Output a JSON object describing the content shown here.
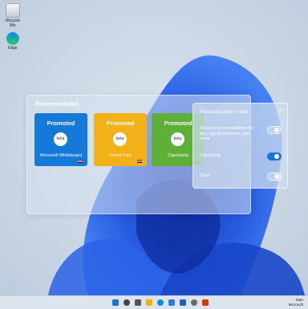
{
  "desktop": {
    "icons": [
      {
        "label": "Recycle Bin",
        "icon": "recycle-bin-icon"
      },
      {
        "label": "Edge",
        "icon": "edge-icon"
      }
    ]
  },
  "recommended": {
    "title": "Recommended",
    "cards": [
      {
        "promo": "Promoted",
        "badge": "beta",
        "name": "Microsoft Whiteboard",
        "color": "#1479d9"
      },
      {
        "promo": "Promoted",
        "badge": "beta",
        "name": "PowerToys",
        "color": "#f3b118"
      },
      {
        "promo": "Promoted",
        "badge": "beta",
        "name": "Clipchamp",
        "color": "#5fb038"
      }
    ]
  },
  "settings_panel": {
    "breadcrumb": "Personalization > Start",
    "close": "×",
    "rows": [
      {
        "label": "Show recommendations for tips, app promotions, and more",
        "on": false
      },
      {
        "label": "Clipchamp",
        "on": true
      },
      {
        "label": "Docx",
        "on": false
      }
    ]
  },
  "taskbar": {
    "icons": [
      "start-icon",
      "search-icon",
      "task-view-icon",
      "file-explorer-icon",
      "edge-icon",
      "store-icon",
      "mail-icon",
      "settings-icon",
      "office-icon"
    ],
    "time": "Start",
    "date": "Microsoft"
  }
}
